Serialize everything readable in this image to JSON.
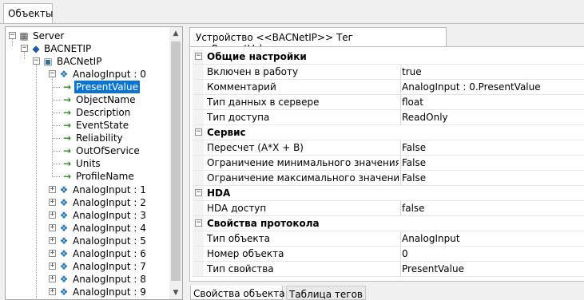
{
  "top_tab": "Объекты",
  "tree": {
    "server": "Server",
    "network": "BACNETIP",
    "device": "BACNetIP",
    "object": "AnalogInput : 0",
    "properties": [
      "PresentValue",
      "ObjectName",
      "Description",
      "EventState",
      "Reliability",
      "OutOfService",
      "Units",
      "ProfileName"
    ],
    "objects": [
      "AnalogInput : 1",
      "AnalogInput : 2",
      "AnalogInput : 3",
      "AnalogInput : 4",
      "AnalogInput : 5",
      "AnalogInput : 6",
      "AnalogInput : 7",
      "AnalogInput : 8",
      "AnalogInput : 9"
    ]
  },
  "right_tab": "Устройство <<BACNetIP>> Тег  <<PresentValue>>",
  "grid": {
    "cat1": "Общие настройки",
    "r1": {
      "k": "Включен в работу",
      "v": "true"
    },
    "r2": {
      "k": "Комментарий",
      "v": "AnalogInput : 0.PresentValue"
    },
    "r3": {
      "k": "Тип данных в сервере",
      "v": "float"
    },
    "r4": {
      "k": "Тип доступа",
      "v": "ReadOnly"
    },
    "cat2": "Сервис",
    "r5": {
      "k": "Пересчет (A*X + B)",
      "v": "False"
    },
    "r6": {
      "k": "Ограничение минимального значения",
      "v": "False"
    },
    "r7": {
      "k": "Ограничение максимального значения",
      "v": "False"
    },
    "cat3": "HDA",
    "r8": {
      "k": "HDA доступ",
      "v": "false"
    },
    "cat4": "Свойства протокола",
    "r9": {
      "k": "Тип объекта",
      "v": "AnalogInput"
    },
    "r10": {
      "k": "Номер объекта",
      "v": "0"
    },
    "r11": {
      "k": "Тип свойства",
      "v": "PresentValue"
    }
  },
  "bottom_tabs": {
    "active": "Свойства объекта",
    "inactive": "Таблица тегов"
  },
  "icons": {
    "expander_collapse": "−",
    "expander_expand": "+",
    "property_arrow": "→"
  }
}
